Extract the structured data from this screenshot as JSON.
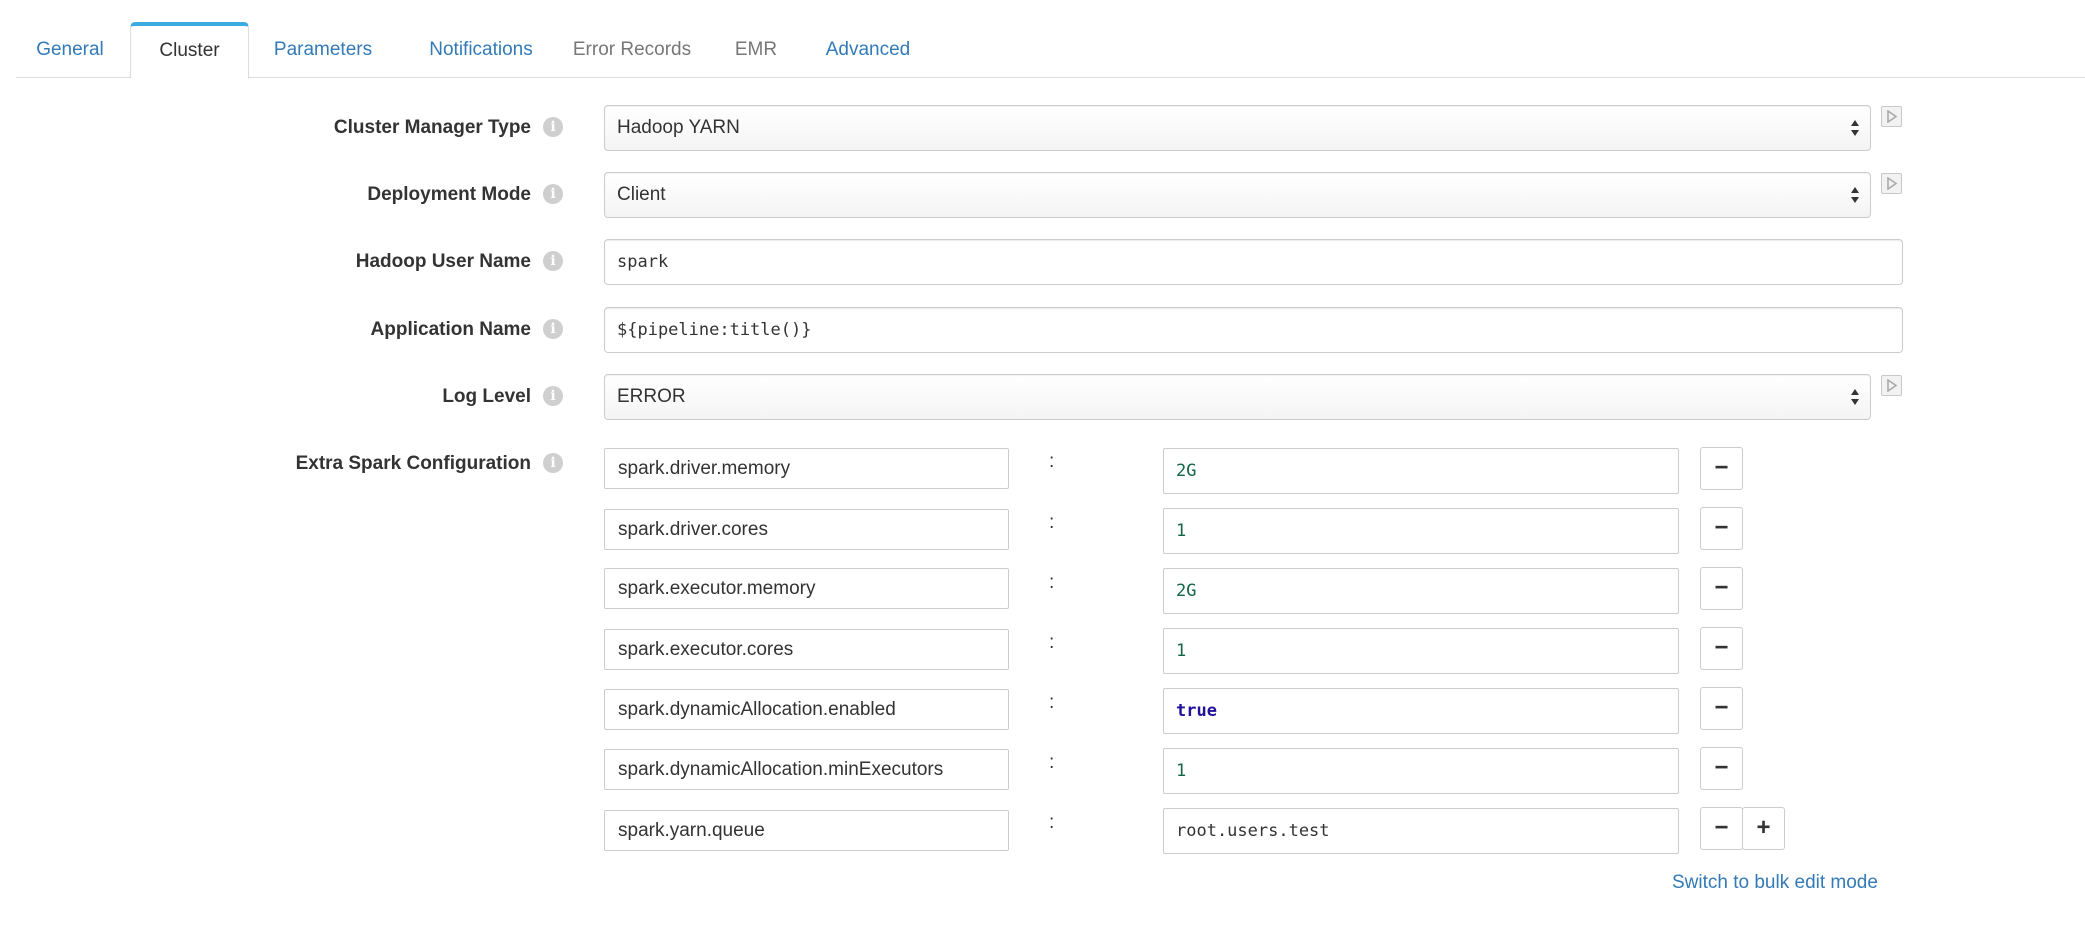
{
  "tabs": [
    {
      "label": "General",
      "state": "link"
    },
    {
      "label": "Cluster",
      "state": "active"
    },
    {
      "label": "Parameters",
      "state": "link"
    },
    {
      "label": "Notifications",
      "state": "link"
    },
    {
      "label": "Error Records",
      "state": "disabled"
    },
    {
      "label": "EMR",
      "state": "disabled"
    },
    {
      "label": "Advanced",
      "state": "link"
    }
  ],
  "form": {
    "cluster_manager_type": {
      "label": "Cluster Manager Type",
      "value": "Hadoop YARN"
    },
    "deployment_mode": {
      "label": "Deployment Mode",
      "value": "Client"
    },
    "hadoop_user_name": {
      "label": "Hadoop User Name",
      "value": "spark"
    },
    "application_name": {
      "label": "Application Name",
      "value": "${pipeline:title()}"
    },
    "log_level": {
      "label": "Log Level",
      "value": "ERROR"
    },
    "extra_spark_config": {
      "label": "Extra Spark Configuration",
      "separator": ":",
      "rows": [
        {
          "key": "spark.driver.memory",
          "value": "2G"
        },
        {
          "key": "spark.driver.cores",
          "value": "1"
        },
        {
          "key": "spark.executor.memory",
          "value": "2G"
        },
        {
          "key": "spark.executor.cores",
          "value": "1"
        },
        {
          "key": "spark.dynamicAllocation.enabled",
          "value": "true"
        },
        {
          "key": "spark.dynamicAllocation.minExecutors",
          "value": "1"
        },
        {
          "key": "spark.yarn.queue",
          "value": "root.users.test"
        }
      ],
      "remove_symbol": "−",
      "add_symbol": "+"
    },
    "bulk_edit_link": "Switch to bulk edit mode"
  },
  "icons": {
    "info": "info-circle-icon",
    "play": "play-icon",
    "select_arrows": "sort-arrows-icon"
  },
  "colors": {
    "link": "#337ab7",
    "active_tab_top": "#3daae0",
    "number_value": "#116644",
    "keyword_value": "#221199"
  }
}
